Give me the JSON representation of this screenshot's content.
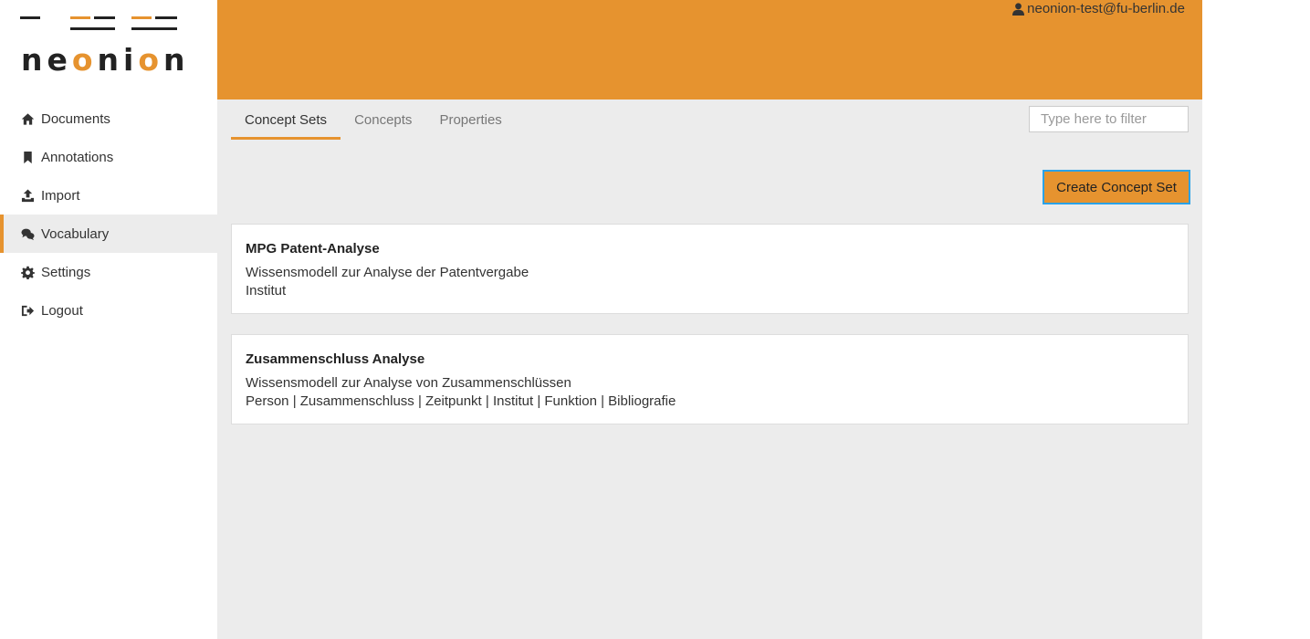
{
  "app": {
    "logo_text": "neonion",
    "accent_color": "#e6932f",
    "focus_color": "#2aa2e8"
  },
  "sidebar": {
    "items": [
      {
        "label": "Documents",
        "icon": "home-icon",
        "active": false
      },
      {
        "label": "Annotations",
        "icon": "bookmark-icon",
        "active": false
      },
      {
        "label": "Import",
        "icon": "upload-icon",
        "active": false
      },
      {
        "label": "Vocabulary",
        "icon": "comments-icon",
        "active": true
      },
      {
        "label": "Settings",
        "icon": "gear-icon",
        "active": false
      },
      {
        "label": "Logout",
        "icon": "sign-out-icon",
        "active": false
      }
    ]
  },
  "header": {
    "user_email": "neonion-test@fu-berlin.de"
  },
  "tabs": [
    {
      "label": "Concept Sets",
      "active": true
    },
    {
      "label": "Concepts",
      "active": false
    },
    {
      "label": "Properties",
      "active": false
    }
  ],
  "filter": {
    "placeholder": "Type here to filter",
    "value": ""
  },
  "actions": {
    "create_label": "Create Concept Set"
  },
  "concept_sets": [
    {
      "title": "MPG Patent-Analyse",
      "description": "Wissensmodell zur Analyse der Patentvergabe",
      "concepts": "Institut"
    },
    {
      "title": "Zusammenschluss Analyse",
      "description": "Wissensmodell zur Analyse von Zusammenschlüssen",
      "concepts": "Person | Zusammenschluss | Zeitpunkt | Institut | Funktion | Bibliografie"
    }
  ]
}
